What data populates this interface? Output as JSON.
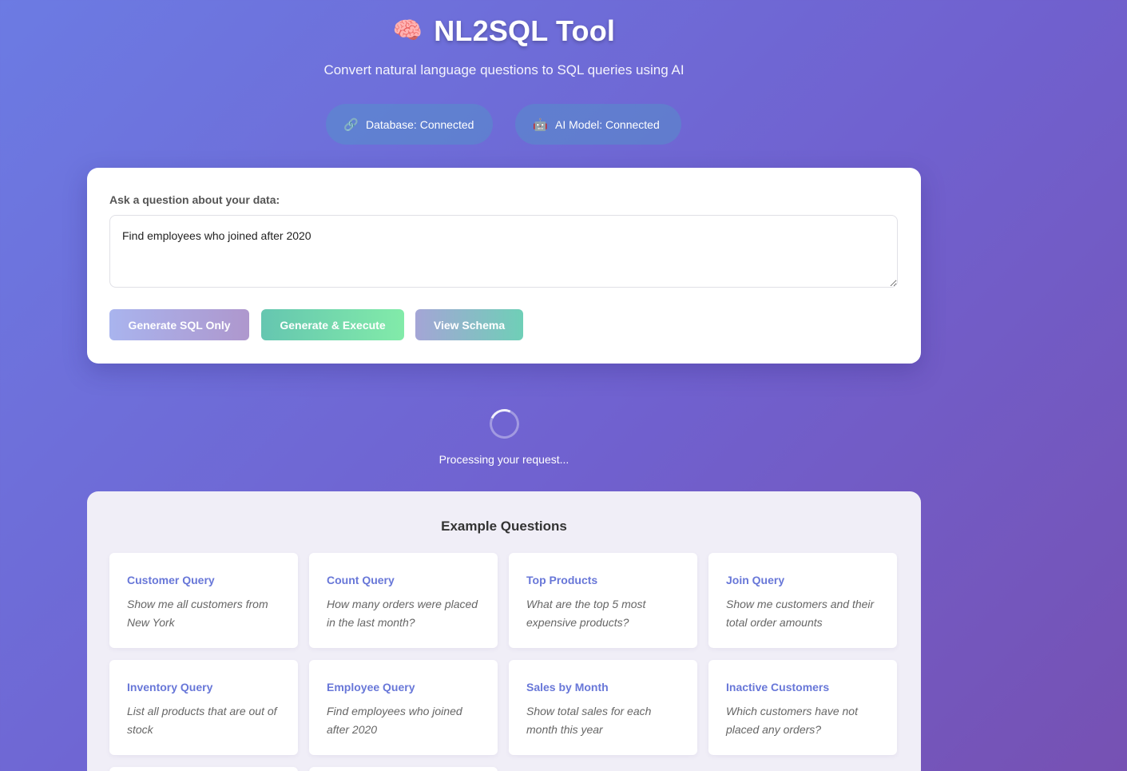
{
  "header": {
    "icon": "🧠",
    "title": "NL2SQL Tool",
    "subtitle": "Convert natural language questions to SQL queries using AI"
  },
  "status": {
    "database": {
      "icon": "🔗",
      "label": "Database: Connected"
    },
    "ai_model": {
      "icon": "🤖",
      "label": "AI Model: Connected"
    }
  },
  "query": {
    "label": "Ask a question about your data:",
    "value": "Find employees who joined after 2020"
  },
  "buttons": {
    "generate_sql": "Generate SQL Only",
    "generate_execute": "Generate & Execute",
    "view_schema": "View Schema"
  },
  "loading": {
    "text": "Processing your request..."
  },
  "examples": {
    "title": "Example Questions",
    "cards": [
      {
        "title": "Customer Query",
        "question": "Show me all customers from New York"
      },
      {
        "title": "Count Query",
        "question": "How many orders were placed in the last month?"
      },
      {
        "title": "Top Products",
        "question": "What are the top 5 most expensive products?"
      },
      {
        "title": "Join Query",
        "question": "Show me customers and their total order amounts"
      },
      {
        "title": "Inventory Query",
        "question": "List all products that are out of stock"
      },
      {
        "title": "Employee Query",
        "question": "Find employees who joined after 2020"
      },
      {
        "title": "Sales by Month",
        "question": "Show total sales for each month this year"
      },
      {
        "title": "Inactive Customers",
        "question": "Which customers have not placed any orders?"
      }
    ]
  }
}
